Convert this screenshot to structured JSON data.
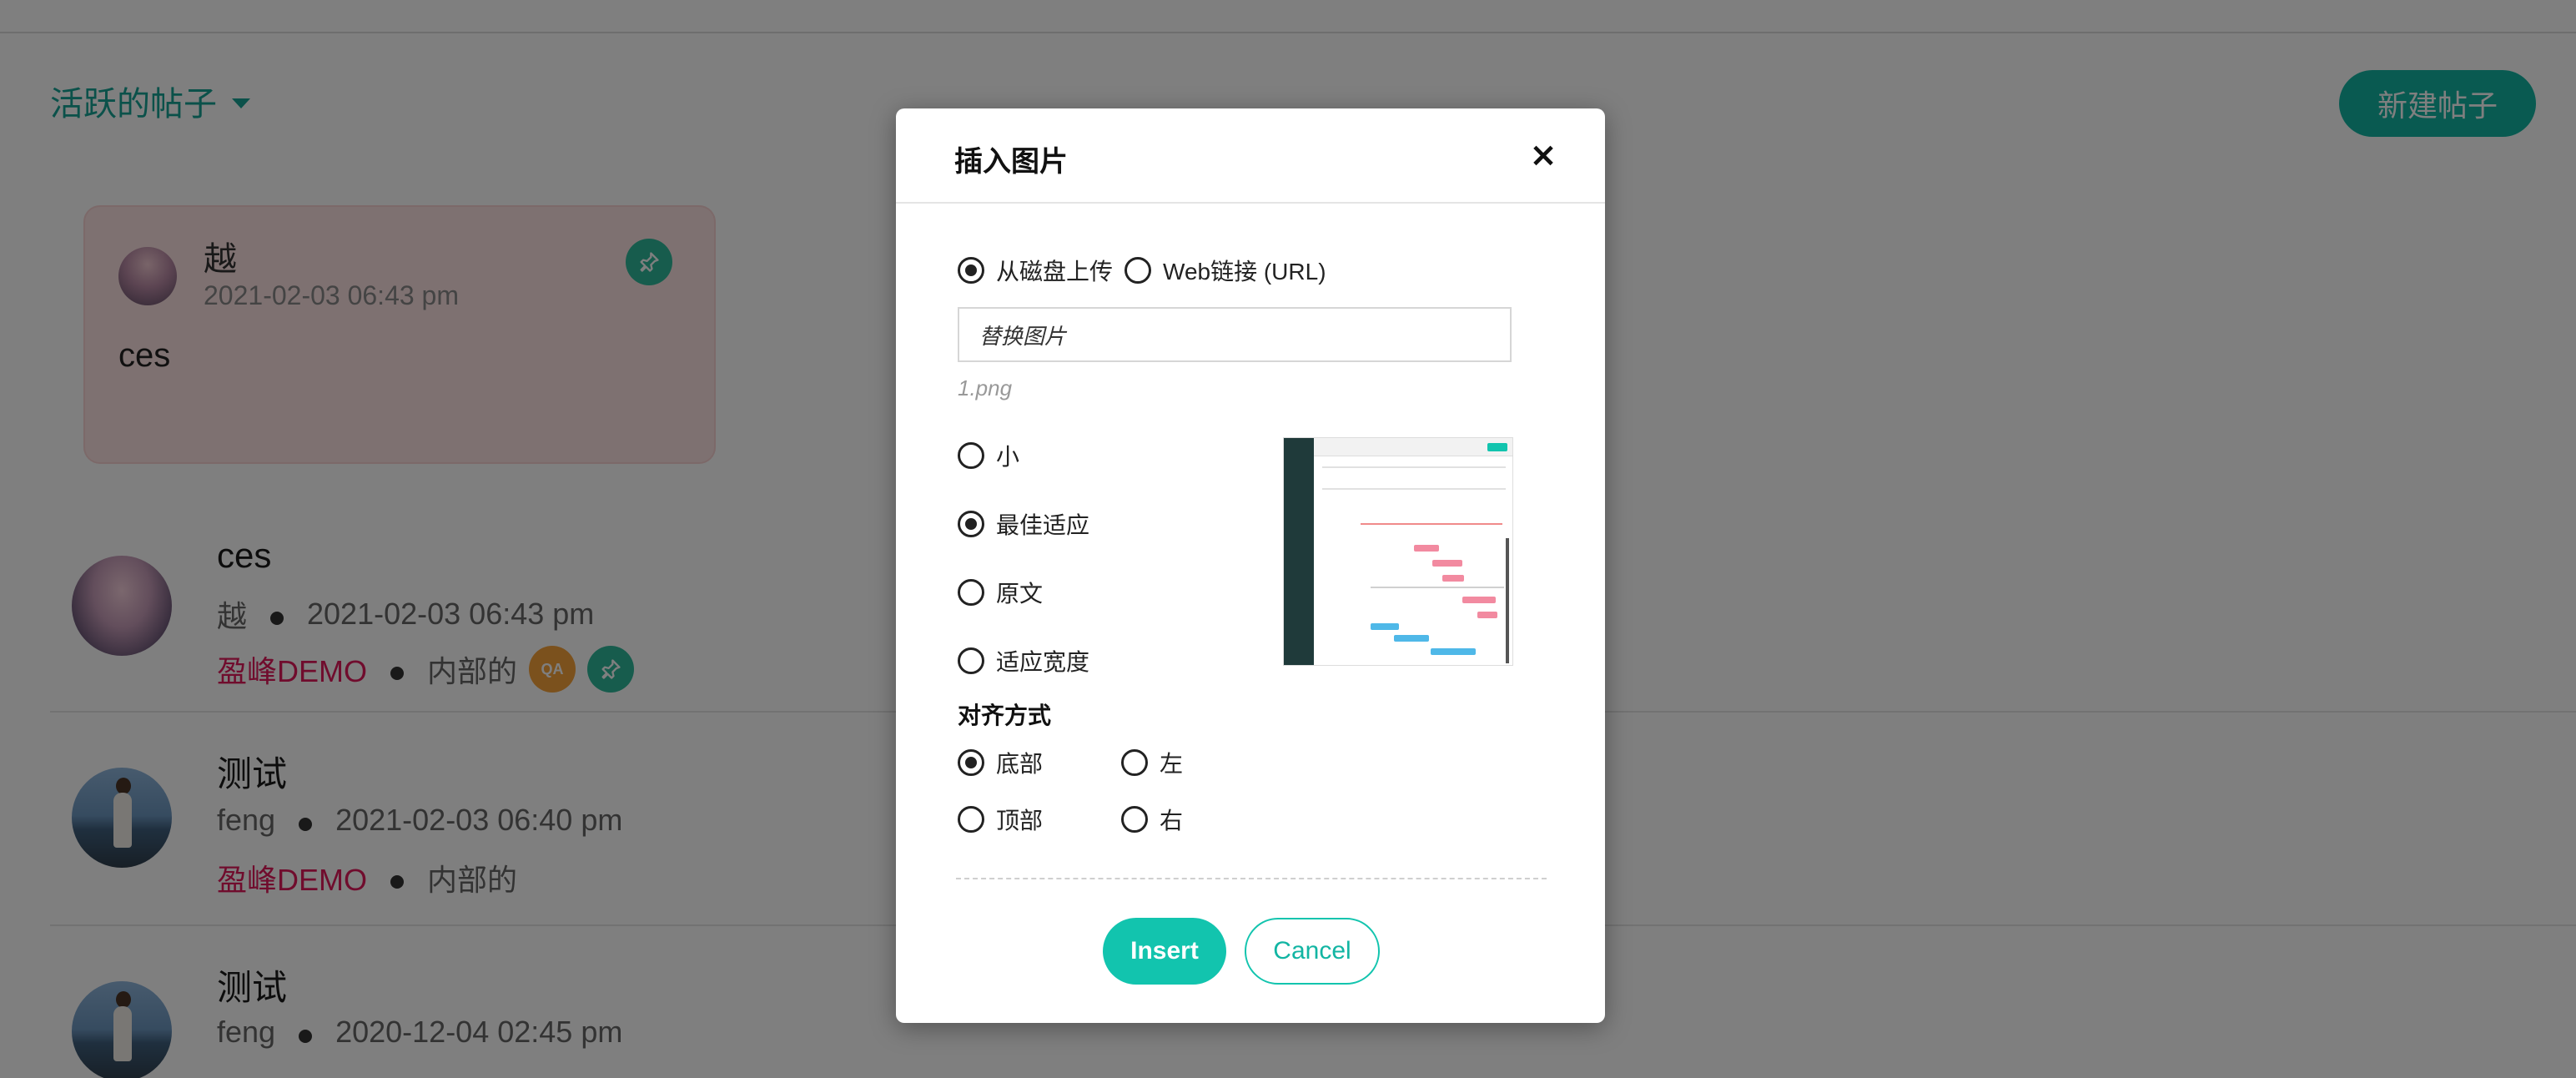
{
  "page": {
    "filter_label": "活跃的帖子",
    "new_post_label": "新建帖子",
    "pinned_post": {
      "author": "越",
      "time": "2021-02-03 06:43 pm",
      "text": "ces"
    },
    "posts": [
      {
        "title": "ces",
        "author": "越",
        "time": "2021-02-03 06:43 pm",
        "course": "盈峰DEMO",
        "visibility": "内部的",
        "qa_badge": "QA"
      },
      {
        "title": "测试",
        "author": "feng",
        "time": "2021-02-03 06:40 pm",
        "course": "盈峰DEMO",
        "visibility": "内部的"
      },
      {
        "title": "测试",
        "author": "feng",
        "time": "2020-12-04 02:45 pm"
      }
    ]
  },
  "modal": {
    "title": "插入图片",
    "close_symbol": "×",
    "source_options": [
      {
        "label": "从磁盘上传",
        "selected": true
      },
      {
        "label": "Web链接 (URL)",
        "selected": false
      }
    ],
    "file_button_label": "替换图片",
    "file_name": "1.png",
    "size_options": [
      {
        "label": "小",
        "selected": false
      },
      {
        "label": "最佳适应",
        "selected": true
      },
      {
        "label": "原文",
        "selected": false
      },
      {
        "label": "适应宽度",
        "selected": false
      }
    ],
    "alignment_label": "对齐方式",
    "alignment_options": [
      {
        "label": "底部",
        "selected": true
      },
      {
        "label": "左",
        "selected": false
      },
      {
        "label": "顶部",
        "selected": false
      },
      {
        "label": "右",
        "selected": false
      }
    ],
    "insert_label": "Insert",
    "cancel_label": "Cancel"
  },
  "colors": {
    "accent": "#12c4ae",
    "link_green": "#16a394",
    "course_red": "#e0195a",
    "overlay": "rgba(0,0,0,0.5)"
  },
  "icons": [
    "chevron-down-icon",
    "pin-icon",
    "close-icon",
    "radio-icon"
  ]
}
